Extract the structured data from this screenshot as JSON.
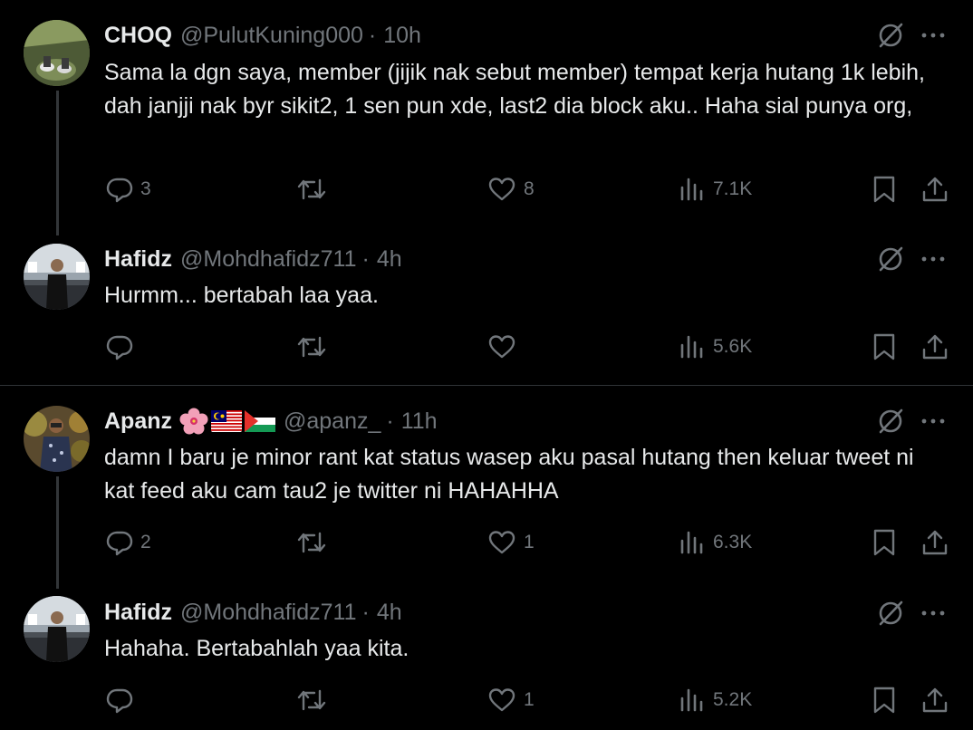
{
  "colors": {
    "background": "#000000",
    "text": "#e7e9ea",
    "muted": "#71767b",
    "line": "#333639"
  },
  "tweets": [
    {
      "name": "CHOQ",
      "handle": "@PulutKuning000",
      "separator": "·",
      "time": "10h",
      "text": "Sama la dgn saya, member (jijik nak sebut member) tempat kerja hutang 1k lebih, dah janjji nak byr sikit2, 1 sen pun xde, last2 dia block aku.. Haha sial punya org,",
      "replies": "3",
      "retweets": "",
      "likes": "8",
      "views": "7.1K"
    },
    {
      "name": "Hafidz",
      "handle": "@Mohdhafidz711",
      "separator": "·",
      "time": "4h",
      "text": "Hurmm... bertabah laa yaa.",
      "replies": "",
      "retweets": "",
      "likes": "",
      "views": "5.6K"
    },
    {
      "name": "Apanz",
      "flags": [
        "hibiscus-emoji",
        "malaysia-flag",
        "palestine-flag"
      ],
      "handle": "@apanz_",
      "separator": "·",
      "time": "11h",
      "text": "damn I baru je minor rant kat status wasep aku pasal hutang then keluar tweet ni kat feed aku cam tau2 je twitter ni HAHAHHA",
      "replies": "2",
      "retweets": "",
      "likes": "1",
      "views": "6.3K"
    },
    {
      "name": "Hafidz",
      "handle": "@Mohdhafidz711",
      "separator": "·",
      "time": "4h",
      "text": "Hahaha. Bertabahlah yaa kita.",
      "replies": "",
      "retweets": "",
      "likes": "1",
      "views": "5.2K"
    }
  ]
}
